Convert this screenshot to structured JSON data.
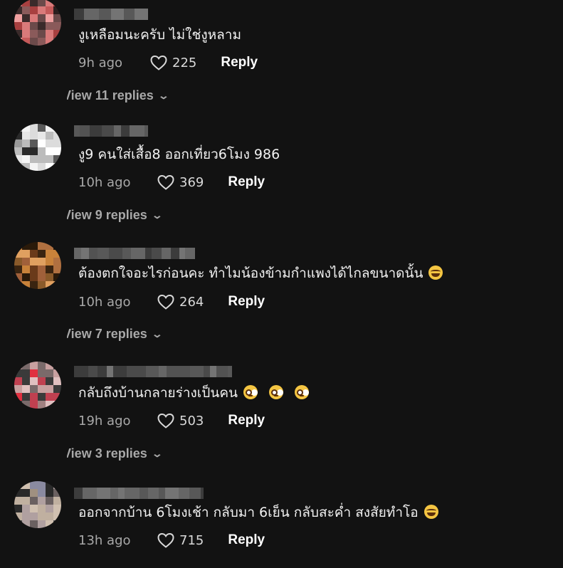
{
  "comments": [
    {
      "text": "งูเหลือมนะครับ ไม่ใช่งูหลาม",
      "time": "9h ago",
      "likes": "225",
      "reply_label": "Reply",
      "view_replies": "View 11 replies",
      "emojis": []
    },
    {
      "text": "งู9 คนใส่เสื้อ8 ออกเที่ยว6โมง 986",
      "time": "10h ago",
      "likes": "369",
      "reply_label": "Reply",
      "view_replies": "View 9 replies",
      "emojis": []
    },
    {
      "text": "ต้องตกใจอะไรก่อนคะ ทำไมน้องข้ามกำแพงได้ไกลขนาดนั้น",
      "time": "10h ago",
      "likes": "264",
      "reply_label": "Reply",
      "view_replies": "View 7 replies",
      "emojis": [
        "laugh"
      ]
    },
    {
      "text": "กลับถึงบ้านกลายร่างเป็นคน",
      "time": "19h ago",
      "likes": "503",
      "reply_label": "Reply",
      "view_replies": "View 3 replies",
      "emojis": [
        "flush",
        "flush",
        "flush"
      ]
    },
    {
      "text": "ออกจากบ้าน 6โมงเช้า กลับมา 6เย็น กลับสะค่ำ สงสัยทำโอ",
      "time": "13h ago",
      "likes": "715",
      "reply_label": "Reply",
      "emojis": [
        "laugh"
      ]
    }
  ],
  "colors": {
    "background": "#121212",
    "muted_text": "#a8a8a8",
    "primary_text": "#ffffff"
  }
}
